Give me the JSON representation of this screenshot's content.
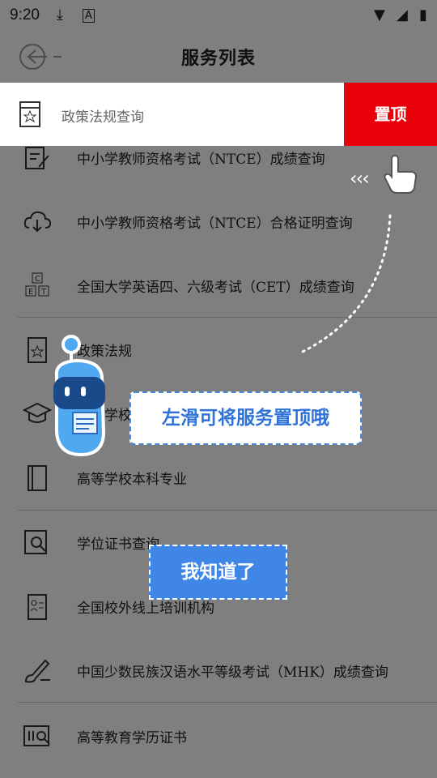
{
  "status_bar": {
    "time": "9:20"
  },
  "header": {
    "title": "服务列表"
  },
  "highlight": {
    "label": "政策法规查询",
    "pin_button": "置顶"
  },
  "services": [
    {
      "label": "中小学教师资格考试（NTCE）成绩查询",
      "icon": "edit-doc-icon"
    },
    {
      "label": "中小学教师资格考试（NTCE）合格证明查询",
      "icon": "cloud-download-icon"
    },
    {
      "label": "全国大学英语四、六级考试（CET）成绩查询",
      "icon": "cet-letters-icon"
    },
    {
      "label": "政策法规",
      "icon": "bookmark-star-icon"
    },
    {
      "label": "高等学校",
      "icon": "graduation-cap-icon"
    },
    {
      "label": "高等学校本科专业",
      "icon": "book-icon"
    },
    {
      "label": "学位证书查询",
      "icon": "doc-search-icon"
    },
    {
      "label": "全国校外线上培训机构",
      "icon": "id-card-icon"
    },
    {
      "label": "中国少数民族汉语水平等级考试（MHK）成绩查询",
      "icon": "brush-icon"
    },
    {
      "label": "高等教育学历证书",
      "icon": "certificate-search-icon"
    }
  ],
  "guide": {
    "tip": "左滑可将服务置顶哦",
    "ok_button": "我知道了"
  },
  "colors": {
    "accent_blue": "#3f86e6",
    "pin_red": "#e8000b",
    "tip_text": "#2f73d8"
  }
}
